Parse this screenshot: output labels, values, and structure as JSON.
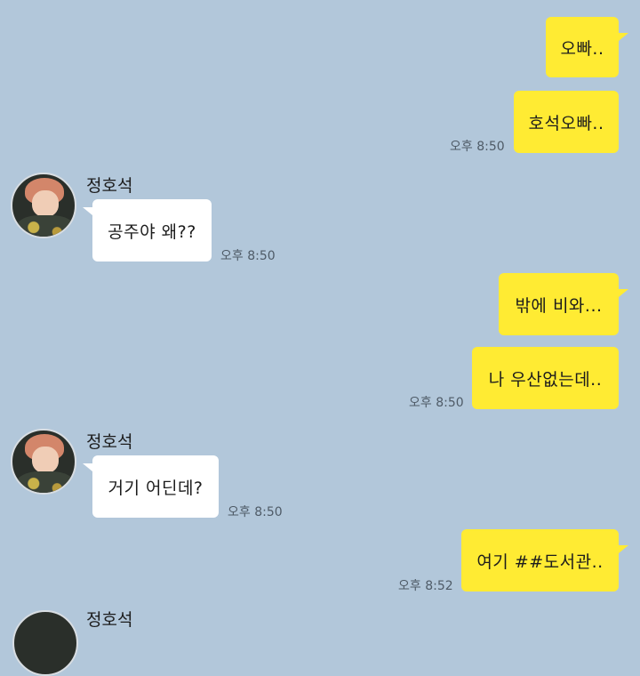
{
  "contact": {
    "name": "정호석"
  },
  "messages": [
    {
      "text": "오빠..",
      "from": "me"
    },
    {
      "text": "호석오빠..",
      "from": "me",
      "time": "오후 8:50"
    },
    {
      "text": "공주야 왜??",
      "from": "them",
      "time": "오후 8:50"
    },
    {
      "text": "밖에 비와...",
      "from": "me"
    },
    {
      "text": "나 우산없는데..",
      "from": "me",
      "time": "오후 8:50"
    },
    {
      "text": "거기 어딘데?",
      "from": "them",
      "time": "오후 8:50"
    },
    {
      "text": "여기 ##도서관..",
      "from": "me",
      "time": "오후 8:52"
    }
  ],
  "partial_sender": "정호석",
  "colors": {
    "background": "#b2c7da",
    "my_bubble": "#ffeb33",
    "their_bubble": "#ffffff"
  },
  "icons": {
    "avatar": "profile-photo"
  }
}
